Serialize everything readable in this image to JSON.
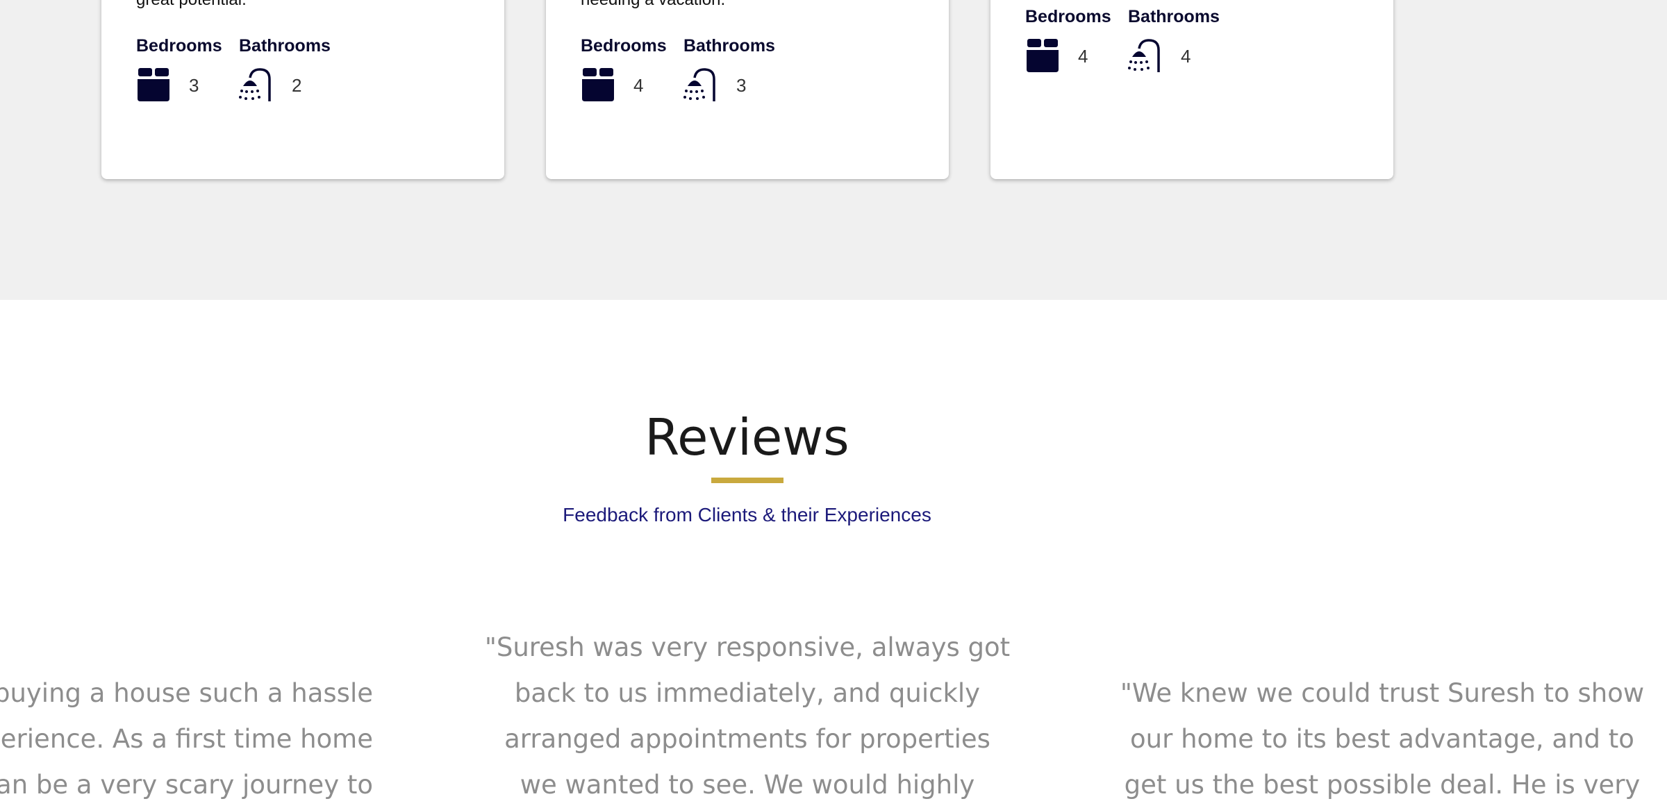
{
  "listings": [
    {
      "description_tail": "great potential.",
      "bedrooms_label": "Bedrooms",
      "bedrooms": "3",
      "bathrooms_label": "Bathrooms",
      "bathrooms": "2",
      "bed_icon": "bed-icon",
      "bath_icon": "shower-icon"
    },
    {
      "description_tail": "needing a vacation.",
      "bedrooms_label": "Bedrooms",
      "bedrooms": "4",
      "bathrooms_label": "Bathrooms",
      "bathrooms": "3",
      "bed_icon": "bed-icon",
      "bath_icon": "shower-icon"
    },
    {
      "description_tail": "",
      "bedrooms_label": "Bedrooms",
      "bedrooms": "4",
      "bathrooms_label": "Bathrooms",
      "bathrooms": "4",
      "bed_icon": "bed-icon",
      "bath_icon": "shower-icon"
    }
  ],
  "reviews": {
    "title": "Reviews",
    "subtitle": "Feedback from Clients & their Experiences",
    "accent_color": "#c9a93e",
    "items": [
      {
        "lines": [
          "buying a house such a hassle",
          "erience. As a first time home",
          "an be a very scary journey to"
        ]
      },
      {
        "lines": [
          "\"Suresh was very responsive, always got",
          "back to us immediately, and quickly",
          "arranged appointments for properties",
          "we wanted to see. We would highly"
        ]
      },
      {
        "lines": [
          "\"We knew we could trust Suresh to show",
          "our home to its best advantage, and to",
          "get us the best possible deal. He is very"
        ]
      }
    ]
  }
}
